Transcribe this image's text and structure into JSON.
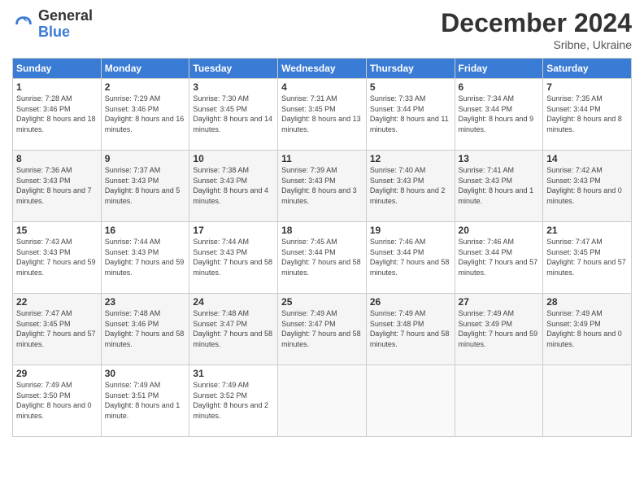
{
  "logo": {
    "general": "General",
    "blue": "Blue"
  },
  "header": {
    "month": "December 2024",
    "location": "Sribne, Ukraine"
  },
  "weekdays": [
    "Sunday",
    "Monday",
    "Tuesday",
    "Wednesday",
    "Thursday",
    "Friday",
    "Saturday"
  ],
  "weeks": [
    [
      {
        "day": 1,
        "sunrise": "7:28 AM",
        "sunset": "3:46 PM",
        "daylight": "8 hours and 18 minutes."
      },
      {
        "day": 2,
        "sunrise": "7:29 AM",
        "sunset": "3:46 PM",
        "daylight": "8 hours and 16 minutes."
      },
      {
        "day": 3,
        "sunrise": "7:30 AM",
        "sunset": "3:45 PM",
        "daylight": "8 hours and 14 minutes."
      },
      {
        "day": 4,
        "sunrise": "7:31 AM",
        "sunset": "3:45 PM",
        "daylight": "8 hours and 13 minutes."
      },
      {
        "day": 5,
        "sunrise": "7:33 AM",
        "sunset": "3:44 PM",
        "daylight": "8 hours and 11 minutes."
      },
      {
        "day": 6,
        "sunrise": "7:34 AM",
        "sunset": "3:44 PM",
        "daylight": "8 hours and 9 minutes."
      },
      {
        "day": 7,
        "sunrise": "7:35 AM",
        "sunset": "3:44 PM",
        "daylight": "8 hours and 8 minutes."
      }
    ],
    [
      {
        "day": 8,
        "sunrise": "7:36 AM",
        "sunset": "3:43 PM",
        "daylight": "8 hours and 7 minutes."
      },
      {
        "day": 9,
        "sunrise": "7:37 AM",
        "sunset": "3:43 PM",
        "daylight": "8 hours and 5 minutes."
      },
      {
        "day": 10,
        "sunrise": "7:38 AM",
        "sunset": "3:43 PM",
        "daylight": "8 hours and 4 minutes."
      },
      {
        "day": 11,
        "sunrise": "7:39 AM",
        "sunset": "3:43 PM",
        "daylight": "8 hours and 3 minutes."
      },
      {
        "day": 12,
        "sunrise": "7:40 AM",
        "sunset": "3:43 PM",
        "daylight": "8 hours and 2 minutes."
      },
      {
        "day": 13,
        "sunrise": "7:41 AM",
        "sunset": "3:43 PM",
        "daylight": "8 hours and 1 minute."
      },
      {
        "day": 14,
        "sunrise": "7:42 AM",
        "sunset": "3:43 PM",
        "daylight": "8 hours and 0 minutes."
      }
    ],
    [
      {
        "day": 15,
        "sunrise": "7:43 AM",
        "sunset": "3:43 PM",
        "daylight": "7 hours and 59 minutes."
      },
      {
        "day": 16,
        "sunrise": "7:44 AM",
        "sunset": "3:43 PM",
        "daylight": "7 hours and 59 minutes."
      },
      {
        "day": 17,
        "sunrise": "7:44 AM",
        "sunset": "3:43 PM",
        "daylight": "7 hours and 58 minutes."
      },
      {
        "day": 18,
        "sunrise": "7:45 AM",
        "sunset": "3:44 PM",
        "daylight": "7 hours and 58 minutes."
      },
      {
        "day": 19,
        "sunrise": "7:46 AM",
        "sunset": "3:44 PM",
        "daylight": "7 hours and 58 minutes."
      },
      {
        "day": 20,
        "sunrise": "7:46 AM",
        "sunset": "3:44 PM",
        "daylight": "7 hours and 57 minutes."
      },
      {
        "day": 21,
        "sunrise": "7:47 AM",
        "sunset": "3:45 PM",
        "daylight": "7 hours and 57 minutes."
      }
    ],
    [
      {
        "day": 22,
        "sunrise": "7:47 AM",
        "sunset": "3:45 PM",
        "daylight": "7 hours and 57 minutes."
      },
      {
        "day": 23,
        "sunrise": "7:48 AM",
        "sunset": "3:46 PM",
        "daylight": "7 hours and 58 minutes."
      },
      {
        "day": 24,
        "sunrise": "7:48 AM",
        "sunset": "3:47 PM",
        "daylight": "7 hours and 58 minutes."
      },
      {
        "day": 25,
        "sunrise": "7:49 AM",
        "sunset": "3:47 PM",
        "daylight": "7 hours and 58 minutes."
      },
      {
        "day": 26,
        "sunrise": "7:49 AM",
        "sunset": "3:48 PM",
        "daylight": "7 hours and 58 minutes."
      },
      {
        "day": 27,
        "sunrise": "7:49 AM",
        "sunset": "3:49 PM",
        "daylight": "7 hours and 59 minutes."
      },
      {
        "day": 28,
        "sunrise": "7:49 AM",
        "sunset": "3:49 PM",
        "daylight": "8 hours and 0 minutes."
      }
    ],
    [
      {
        "day": 29,
        "sunrise": "7:49 AM",
        "sunset": "3:50 PM",
        "daylight": "8 hours and 0 minutes."
      },
      {
        "day": 30,
        "sunrise": "7:49 AM",
        "sunset": "3:51 PM",
        "daylight": "8 hours and 1 minute."
      },
      {
        "day": 31,
        "sunrise": "7:49 AM",
        "sunset": "3:52 PM",
        "daylight": "8 hours and 2 minutes."
      },
      null,
      null,
      null,
      null
    ]
  ]
}
